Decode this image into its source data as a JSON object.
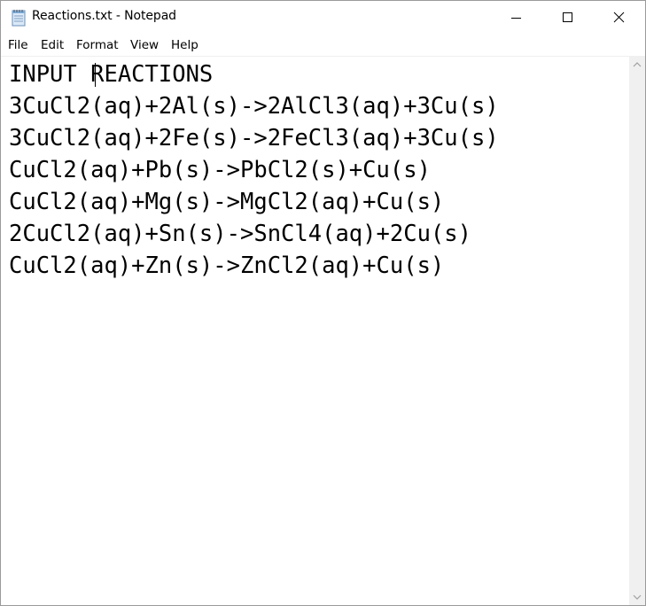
{
  "window": {
    "title": "Reactions.txt - Notepad"
  },
  "menu": {
    "file": "File",
    "edit": "Edit",
    "format": "Format",
    "view": "View",
    "help": "Help"
  },
  "document": {
    "lines": [
      "INPUT REACTIONS",
      "3CuCl2(aq)+2Al(s)->2AlCl3(aq)+3Cu(s)",
      "3CuCl2(aq)+2Fe(s)->2FeCl3(aq)+3Cu(s)",
      "CuCl2(aq)+Pb(s)->PbCl2(s)+Cu(s)",
      "CuCl2(aq)+Mg(s)->MgCl2(aq)+Cu(s)",
      "2CuCl2(aq)+Sn(s)->SnCl4(aq)+2Cu(s)",
      "CuCl2(aq)+Zn(s)->ZnCl2(aq)+Cu(s)"
    ]
  },
  "icons": {
    "app": "notepad-icon",
    "minimize": "minimize-icon",
    "maximize": "maximize-icon",
    "close": "close-icon",
    "scroll_up": "scroll-up-arrow-icon",
    "scroll_down": "scroll-down-arrow-icon"
  }
}
